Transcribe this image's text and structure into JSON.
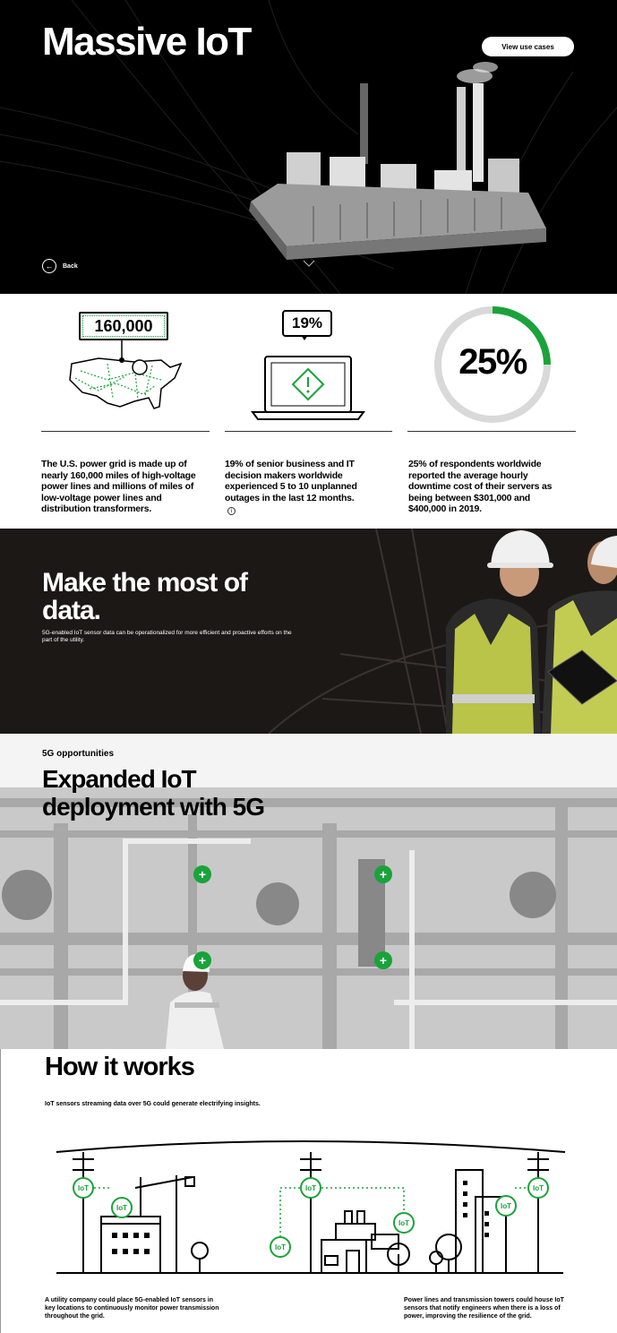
{
  "hero": {
    "title": "Massive IoT",
    "view_button": "View use cases",
    "back_label": "Back"
  },
  "stats": [
    {
      "badge": "160,000",
      "text": "The U.S. power grid is made up of nearly 160,000 miles of high-voltage power lines and millions of miles of low-voltage power lines and distribution transformers."
    },
    {
      "badge": "19%",
      "text": "19% of senior business and IT decision makers worldwide experienced 5 to 10 unplanned outages in the last 12 months."
    },
    {
      "badge": "25%",
      "progress": 0.25,
      "text": "25% of respondents worldwide reported the average hourly downtime cost of their servers as being between $301,000 and $400,000 in 2019."
    }
  ],
  "info_icon": "info-icon",
  "data_section": {
    "title": "Make the most of data.",
    "subtitle": "5G-enabled IoT sensor data can be operationalized for more efficient and proactive efforts on the part of the utility."
  },
  "fiveg": {
    "kicker": "5G opportunities",
    "title": "Expanded IoT deployment with 5G",
    "hotspot_symbol": "+"
  },
  "how": {
    "title": "How it works",
    "subtitle": "IoT sensors streaming data over 5G could generate electrifying insights.",
    "sensor_label": "IoT",
    "caption_left": "A utility company could place 5G-enabled IoT sensors in key locations to continuously monitor power transmission throughout the grid.",
    "caption_right": "Power lines and transmission towers could house IoT sensors that notify engineers when there is a loss of power, improving the resilience of the grid."
  },
  "colors": {
    "accent": "#1aa33a",
    "dark": "#000000",
    "data_bg": "#1c1816"
  }
}
